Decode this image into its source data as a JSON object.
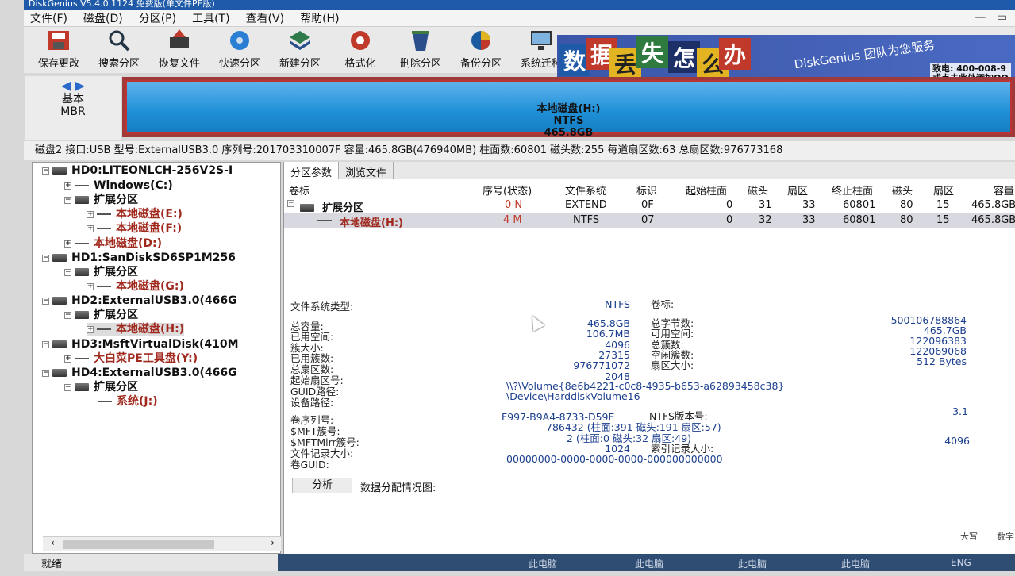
{
  "title": "DiskGenius V5.4.0.1124 免费版(单文件PE版)",
  "menu": [
    "文件(F)",
    "磁盘(D)",
    "分区(P)",
    "工具(T)",
    "查看(V)",
    "帮助(H)"
  ],
  "toolbar": [
    "保存更改",
    "搜索分区",
    "恢复文件",
    "快速分区",
    "新建分区",
    "格式化",
    "删除分区",
    "备份分区",
    "系统迁移"
  ],
  "banner": {
    "chars": [
      "数",
      "据",
      "丢",
      "失",
      "怎",
      "么",
      "办"
    ],
    "brand": "DiskGenius 团队为您服务",
    "phone": "400-008-9",
    "phone_label": "致电:",
    "note": "或点击此处添加QQ"
  },
  "disk_nav": {
    "type": "基本",
    "scheme": "MBR"
  },
  "disk_bar": {
    "name": "本地磁盘(H:)",
    "fs": "NTFS",
    "size": "465.8GB"
  },
  "disk_info": "磁盘2 接口:USB  型号:ExternalUSB3.0  序列号:201703310007F  容量:465.8GB(476940MB)  柱面数:60801  磁头数:255  每道扇区数:63  总扇区数:976773168",
  "tree": [
    {
      "label": "HD0:LITEONLCH-256V2S-I"
    },
    {
      "label": "Windows(C:)"
    },
    {
      "label": "扩展分区"
    },
    {
      "label": "本地磁盘(E:)"
    },
    {
      "label": "本地磁盘(F:)"
    },
    {
      "label": "本地磁盘(D:)"
    },
    {
      "label": "HD1:SanDiskSD6SP1M256"
    },
    {
      "label": "扩展分区"
    },
    {
      "label": "本地磁盘(G:)"
    },
    {
      "label": "HD2:ExternalUSB3.0(466G"
    },
    {
      "label": "扩展分区"
    },
    {
      "label": "本地磁盘(H:)"
    },
    {
      "label": "HD3:MsftVirtualDisk(410M"
    },
    {
      "label": "大白菜PE工具盘(Y:)"
    },
    {
      "label": "HD4:ExternalUSB3.0(466G"
    },
    {
      "label": "扩展分区"
    },
    {
      "label": "系统(J:)"
    }
  ],
  "tabs": [
    "分区参数",
    "浏览文件"
  ],
  "columns": [
    "卷标",
    "序号(状态)",
    "文件系统",
    "标识",
    "起始柱面",
    "磁头",
    "扇区",
    "终止柱面",
    "磁头",
    "扇区",
    "容量"
  ],
  "rows": [
    [
      "扩展分区",
      "0 N",
      "EXTEND",
      "0F",
      "0",
      "31",
      "33",
      "60801",
      "80",
      "15",
      "465.8GB"
    ],
    [
      "本地磁盘(H:)",
      "4 M",
      "NTFS",
      "07",
      "0",
      "32",
      "33",
      "60801",
      "80",
      "15",
      "465.8GB"
    ]
  ],
  "props": {
    "fs_type_label": "文件系统类型:",
    "fs_type": "NTFS",
    "vol_label": "卷标:",
    "left_labels": [
      "总容量:",
      "已用空间:",
      "簇大小:",
      "已用簇数:",
      "总扇区数:",
      "起始扇区号:",
      "GUID路径:",
      "设备路径:"
    ],
    "left_values": [
      "465.8GB",
      "106.7MB",
      "4096",
      "27315",
      "976771072",
      "2048"
    ],
    "right_labels": [
      "总字节数:",
      "可用空间:",
      "总簇数:",
      "空闲簇数:",
      "扇区大小:"
    ],
    "right_values": [
      "500106788864",
      "465.7GB",
      "122096383",
      "122069068",
      "512 Bytes"
    ],
    "guid_path": "\\\\?\\Volume{8e6b4221-c0c8-4935-b653-a62893458c38}",
    "device_path": "\\Device\\HarddiskVolume16",
    "serial_label": "卷序列号:",
    "serial": "F997-B9A4-8733-D59E",
    "ntfs_ver_label": "NTFS版本号:",
    "ntfs_ver": "3.1",
    "mft_label": "$MFT簇号:",
    "mft": "786432 (柱面:391 磁头:191 扇区:57)",
    "mftmirr_label": "$MFTMirr簇号:",
    "mftmirr": "2 (柱面:0 磁头:32 扇区:49)",
    "rec_label": "文件记录大小:",
    "rec": "1024",
    "idx_label": "索引记录大小:",
    "idx": "4096",
    "guid_label": "卷GUID:",
    "guid": "00000000-0000-0000-0000-000000000000",
    "analyze": "分析",
    "alloc": "数据分配情况图:"
  },
  "status": "就绪",
  "taskbar": {
    "items": [
      "此电脑",
      "此电脑",
      "此电脑",
      "此电脑"
    ],
    "lang": "ENG",
    "corner_labels": [
      "大写",
      "数字"
    ]
  }
}
